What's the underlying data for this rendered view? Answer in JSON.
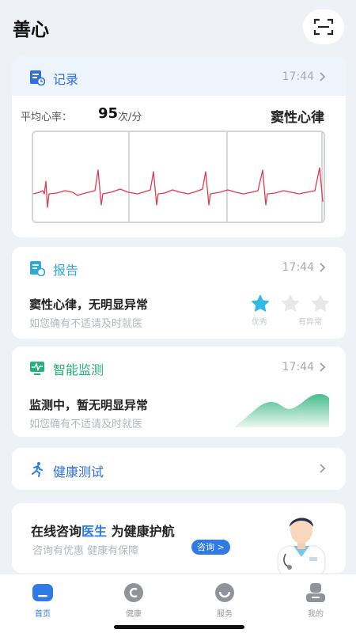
{
  "app": {
    "title": "善心"
  },
  "record": {
    "title": "记录",
    "time": "17:44",
    "avg_hr_label": "平均心率：",
    "avg_hr_value": "95",
    "avg_hr_unit": "次/分",
    "rhythm": "窦性心律"
  },
  "report": {
    "title": "报告",
    "time": "17:44",
    "result": "窦性心律，无明显异常",
    "advice": "如您确有不适请及时就医",
    "rating_labels": [
      "优秀",
      "",
      "有异常"
    ]
  },
  "monitor": {
    "title": "智能监测",
    "time": "17:44",
    "status": "监测中，暂无明显异常",
    "advice": "如您确有不适请及时就医"
  },
  "test": {
    "title": "健康测试"
  },
  "consult": {
    "title_prefix": "在线咨询",
    "title_highlight": "医生",
    "title_suffix": " 为健康护航",
    "subtitle": "咨询有优惠  健康有保障",
    "button": "咨询 >"
  },
  "nav": [
    {
      "label": "首页",
      "icon": "home-icon",
      "active": true
    },
    {
      "label": "健康",
      "icon": "health-icon",
      "active": false
    },
    {
      "label": "服务",
      "icon": "service-icon",
      "active": false
    },
    {
      "label": "我的",
      "icon": "profile-icon",
      "active": false
    }
  ],
  "colors": {
    "accent": "#2f7ae5",
    "report": "#2fa9d6",
    "monitor": "#27b07a",
    "ecg": "#e23a4f"
  }
}
